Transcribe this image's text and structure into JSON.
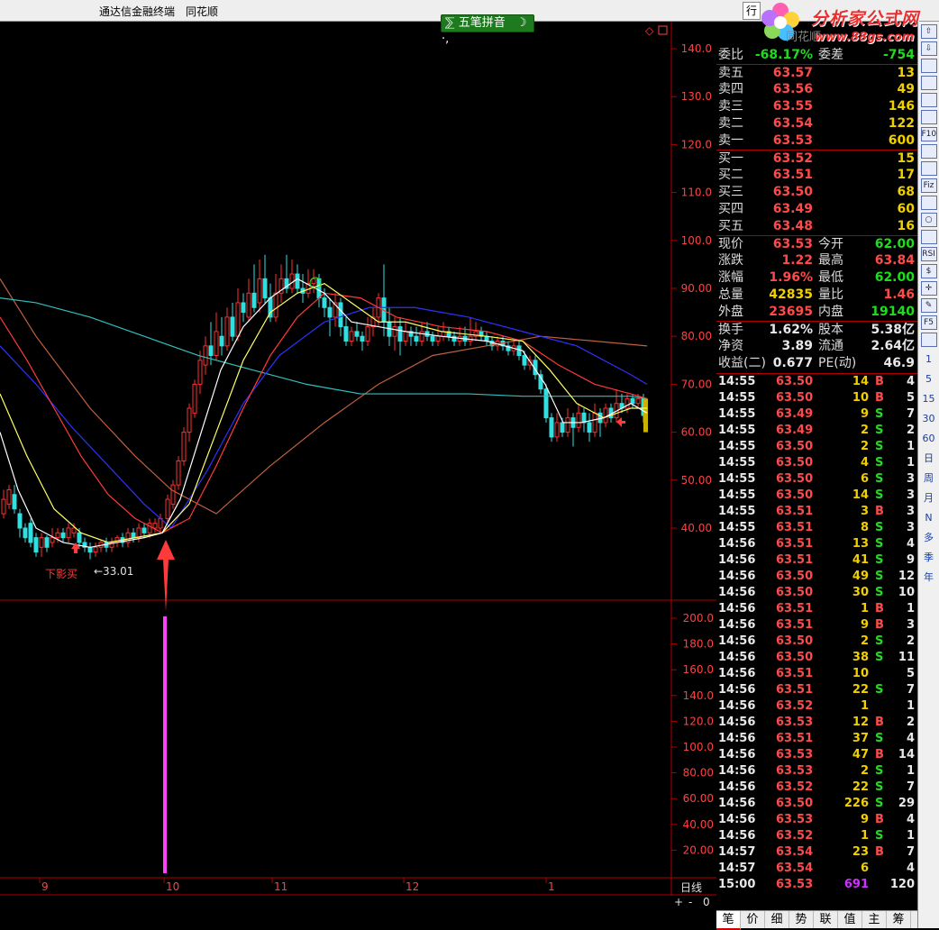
{
  "menu": {
    "items": [
      "通达信金融终端",
      "同花顺"
    ],
    "main_btn": "行"
  },
  "logo": {
    "name": "分析家公式网",
    "url": "www.88gs.com",
    "behind": "同花顺"
  },
  "toolbar": {
    "wubi_label": "五笔拼音"
  },
  "chart_data": {
    "type": "candlestick",
    "price_axis_ticks": [
      "140.0",
      "130.0",
      "120.0",
      "110.0",
      "100.0",
      "90.00",
      "80.00",
      "70.00",
      "60.00",
      "50.00",
      "40.00"
    ],
    "volume_axis_ticks": [
      "200.0",
      "180.0",
      "160.0",
      "140.0",
      "120.0",
      "100.0",
      "80.00",
      "60.00",
      "40.00",
      "20.00"
    ],
    "x_ticks": [
      "9",
      "10",
      "11",
      "12",
      "1"
    ],
    "period_label": "日线",
    "annotations": {
      "low_label": "下影买",
      "low_value": "←33.01"
    },
    "colors": {
      "up": "#ff3030",
      "down": "#30e0e0",
      "ma5": "#ffffff",
      "ma10": "#ffff66",
      "ma20": "#ff3a3a",
      "ma30": "#3030ff",
      "ma60": "#30c0c0",
      "ma120": "#c06040",
      "signal": "#ff40ff"
    }
  },
  "quote": {
    "weibi": {
      "label": "委比",
      "value": "-68.17%",
      "label2": "委差",
      "value2": "-754"
    },
    "sell": [
      {
        "label": "卖五",
        "price": "63.57",
        "vol": "13"
      },
      {
        "label": "卖四",
        "price": "63.56",
        "vol": "49"
      },
      {
        "label": "卖三",
        "price": "63.55",
        "vol": "146"
      },
      {
        "label": "卖二",
        "price": "63.54",
        "vol": "122"
      },
      {
        "label": "卖一",
        "price": "63.53",
        "vol": "600"
      }
    ],
    "buy": [
      {
        "label": "买一",
        "price": "63.52",
        "vol": "15"
      },
      {
        "label": "买二",
        "price": "63.51",
        "vol": "17"
      },
      {
        "label": "买三",
        "price": "63.50",
        "vol": "68"
      },
      {
        "label": "买四",
        "price": "63.49",
        "vol": "60"
      },
      {
        "label": "买五",
        "price": "63.48",
        "vol": "16"
      }
    ],
    "stats": [
      {
        "l": "现价",
        "v": "63.53",
        "vc": "red",
        "l2": "今开",
        "v2": "62.00",
        "v2c": "grn"
      },
      {
        "l": "涨跌",
        "v": "1.22",
        "vc": "red",
        "l2": "最高",
        "v2": "63.84",
        "v2c": "red"
      },
      {
        "l": "涨幅",
        "v": "1.96%",
        "vc": "red",
        "l2": "最低",
        "v2": "62.00",
        "v2c": "grn"
      },
      {
        "l": "总量",
        "v": "42835",
        "vc": "yel",
        "l2": "量比",
        "v2": "1.46",
        "v2c": "red"
      },
      {
        "l": "外盘",
        "v": "23695",
        "vc": "red",
        "l2": "内盘",
        "v2": "19140",
        "v2c": "grn"
      }
    ],
    "fund": [
      {
        "l": "换手",
        "v": "1.62%",
        "l2": "股本",
        "v2": "5.38亿"
      },
      {
        "l": "净资",
        "v": "3.89",
        "l2": "流通",
        "v2": "2.64亿"
      },
      {
        "l": "收益(二)",
        "v": "0.677",
        "l2": "PE(动)",
        "v2": "46.9"
      }
    ]
  },
  "ticks": [
    [
      "14:55",
      "63.50",
      "14",
      "B",
      "4"
    ],
    [
      "14:55",
      "63.50",
      "10",
      "B",
      "5"
    ],
    [
      "14:55",
      "63.49",
      "9",
      "S",
      "7"
    ],
    [
      "14:55",
      "63.49",
      "2",
      "S",
      "2"
    ],
    [
      "14:55",
      "63.50",
      "2",
      "S",
      "1"
    ],
    [
      "14:55",
      "63.50",
      "4",
      "S",
      "1"
    ],
    [
      "14:55",
      "63.50",
      "6",
      "S",
      "3"
    ],
    [
      "14:55",
      "63.50",
      "14",
      "S",
      "3"
    ],
    [
      "14:55",
      "63.51",
      "3",
      "B",
      "3"
    ],
    [
      "14:55",
      "63.51",
      "8",
      "S",
      "3"
    ],
    [
      "14:56",
      "63.51",
      "13",
      "S",
      "4"
    ],
    [
      "14:56",
      "63.51",
      "41",
      "S",
      "9"
    ],
    [
      "14:56",
      "63.50",
      "49",
      "S",
      "12"
    ],
    [
      "14:56",
      "63.50",
      "30",
      "S",
      "10"
    ],
    [
      "14:56",
      "63.51",
      "1",
      "B",
      "1"
    ],
    [
      "14:56",
      "63.51",
      "9",
      "B",
      "3"
    ],
    [
      "14:56",
      "63.50",
      "2",
      "S",
      "2"
    ],
    [
      "14:56",
      "63.50",
      "38",
      "S",
      "11"
    ],
    [
      "14:56",
      "63.51",
      "10",
      "",
      "5"
    ],
    [
      "14:56",
      "63.51",
      "22",
      "S",
      "7"
    ],
    [
      "14:56",
      "63.52",
      "1",
      "",
      "1"
    ],
    [
      "14:56",
      "63.53",
      "12",
      "B",
      "2"
    ],
    [
      "14:56",
      "63.51",
      "37",
      "S",
      "4"
    ],
    [
      "14:56",
      "63.53",
      "47",
      "B",
      "14"
    ],
    [
      "14:56",
      "63.53",
      "2",
      "S",
      "1"
    ],
    [
      "14:56",
      "63.52",
      "22",
      "S",
      "7"
    ],
    [
      "14:56",
      "63.50",
      "226",
      "S",
      "29"
    ],
    [
      "14:56",
      "63.53",
      "9",
      "B",
      "4"
    ],
    [
      "14:56",
      "63.52",
      "1",
      "S",
      "1"
    ],
    [
      "14:57",
      "63.54",
      "23",
      "B",
      "7"
    ],
    [
      "14:57",
      "63.54",
      "6",
      "",
      "4"
    ],
    [
      "15:00",
      "63.53",
      "691",
      "",
      "120"
    ]
  ],
  "bottom_tabs": [
    "笔",
    "价",
    "细",
    "势",
    "联",
    "值",
    "主",
    "筹"
  ],
  "sidebar": {
    "numbers": [
      "1",
      "5",
      "15",
      "30",
      "60"
    ],
    "periods": [
      "日",
      "周",
      "月",
      "N",
      "多",
      "季",
      "年"
    ]
  },
  "zoom": {
    "plus": "+",
    "minus": "-",
    "zero": "0"
  }
}
